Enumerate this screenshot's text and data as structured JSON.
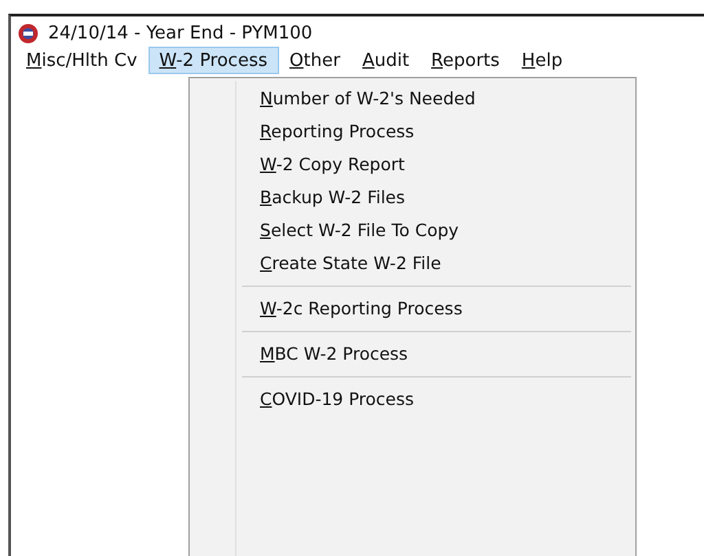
{
  "window": {
    "title": "24/10/14 - Year End - PYM100"
  },
  "menu_bar": [
    {
      "label": "Misc/Hlth Cv",
      "first_letter_underlined": true,
      "selected": false
    },
    {
      "label": "W-2 Process",
      "first_letter_underlined": true,
      "selected": true
    },
    {
      "label": "Other",
      "first_letter_underlined": true,
      "selected": false
    },
    {
      "label": "Audit",
      "first_letter_underlined": true,
      "selected": false
    },
    {
      "label": "Reports",
      "first_letter_underlined": true,
      "selected": false
    },
    {
      "label": "Help",
      "first_letter_underlined": true,
      "selected": false
    }
  ],
  "dropdown": [
    {
      "kind": "item",
      "label": "Number of W-2's Needed",
      "first_letter_underlined": true
    },
    {
      "kind": "item",
      "label": "Reporting Process",
      "first_letter_underlined": true
    },
    {
      "kind": "item",
      "label": "W-2 Copy Report",
      "first_letter_underlined": true
    },
    {
      "kind": "item",
      "label": "Backup W-2 Files",
      "first_letter_underlined": true
    },
    {
      "kind": "item",
      "label": "Select W-2 File To Copy",
      "first_letter_underlined": true
    },
    {
      "kind": "item",
      "label": "Create State W-2 File",
      "first_letter_underlined": true
    },
    {
      "kind": "separator"
    },
    {
      "kind": "item",
      "label": "W-2c Reporting Process",
      "first_letter_underlined": true
    },
    {
      "kind": "separator"
    },
    {
      "kind": "item",
      "label": "MBC W-2 Process",
      "first_letter_underlined": true
    },
    {
      "kind": "separator"
    },
    {
      "kind": "item",
      "label": "COVID-19 Process",
      "first_letter_underlined": true
    }
  ]
}
